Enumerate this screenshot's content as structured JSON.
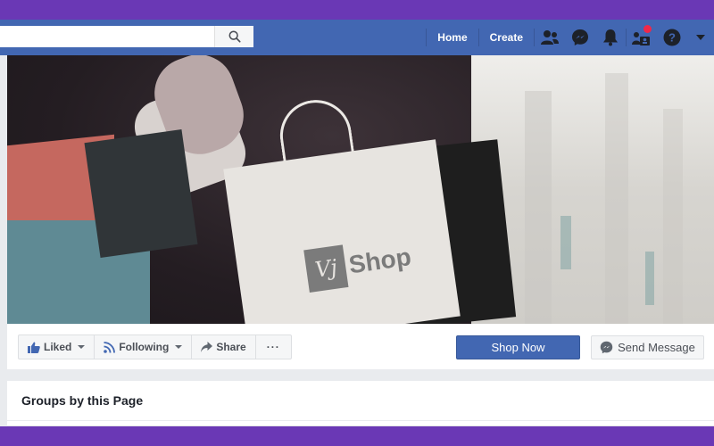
{
  "header": {
    "search": {
      "value": "",
      "placeholder": ""
    },
    "nav": {
      "home_label": "Home",
      "create_label": "Create"
    },
    "icons": [
      "friends-icon",
      "messenger-icon",
      "notifications-icon",
      "friend-requests-icon",
      "help-icon",
      "menu-caret-icon"
    ],
    "brand_color": "#4267b2",
    "notification_dot_color": "#f02849"
  },
  "cover": {
    "logo_mark": "Vj",
    "logo_text": "Shop"
  },
  "actions": {
    "liked_label": "Liked",
    "following_label": "Following",
    "share_label": "Share",
    "more_label": "···",
    "shop_now_label": "Shop Now",
    "send_message_label": "Send Message"
  },
  "groups": {
    "title": "Groups by this Page"
  },
  "frame_color": "#6a38b5"
}
